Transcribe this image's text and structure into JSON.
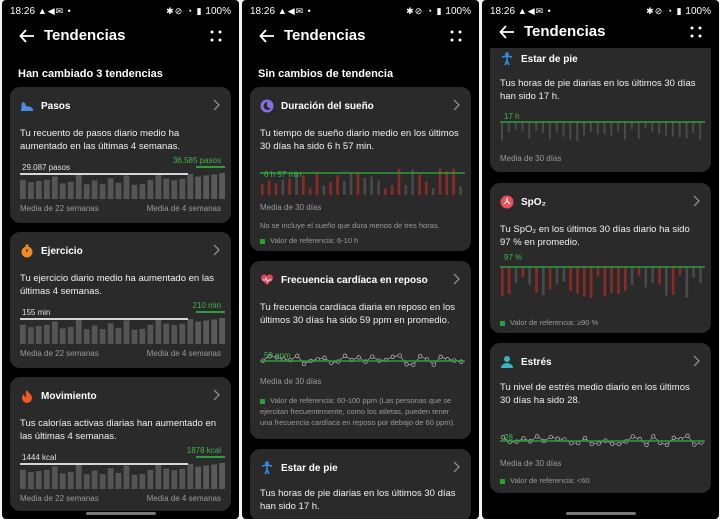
{
  "statusbar": {
    "time": "18:26",
    "left_icons": "▲◀✉ •",
    "right_icons": "✱⊘ ◔ ▮",
    "battery": "100%"
  },
  "appbar": {
    "title": "Tendencias"
  },
  "colors": {
    "card": "#2a2a2a",
    "accent_green": "#2e9d3e",
    "bar_grey": "#5a5a5a",
    "bar_red": "#8b2b25",
    "line_light": "#d6d6d6"
  },
  "screen1": {
    "section": "Han cambiado 3 tendencias",
    "pasos": {
      "title": "Pasos",
      "desc": "Tu recuento de pasos diario medio ha aumentado en las últimas 4 semanas.",
      "left_value": "29.087 pasos",
      "right_value": "36.585 pasos",
      "left_caption": "Media de 22 semanas",
      "right_caption": "Media de 4 semanas"
    },
    "ejercicio": {
      "title": "Ejercicio",
      "desc": "Tu ejercicio diario medio ha aumentado en las últimas 4 semanas.",
      "left_value": "155 min",
      "right_value": "210 min",
      "left_caption": "Media de 22 semanas",
      "right_caption": "Media de 4 semanas"
    },
    "movimiento": {
      "title": "Movimiento",
      "desc": "Tus calorías activas diarias han aumentado en las últimas 4 semanas.",
      "left_value": "1444 kcal",
      "right_value": "1878 kcal",
      "left_caption": "Media de 22 semanas",
      "right_caption": "Media de 4 semanas"
    }
  },
  "screen2": {
    "section": "Sin cambios de tendencia",
    "sueno": {
      "title": "Duración del sueño",
      "desc": "Tu tiempo de sueño diario medio en los últimos 30 días ha sido 6 h 57 min.",
      "line_label": "6 h 57 min",
      "caption": "Media de 30 días",
      "note": "No se incluye el sueño que dura menos de tres horas.",
      "ref": "Valor de referencia: 6-10 h"
    },
    "frecuencia": {
      "title": "Frecuencia cardíaca en reposo",
      "desc": "Tu frecuencia cardíaca diaria en reposo en los últimos 30 días ha sido 59 ppm en promedio.",
      "line_label": "59 ppm",
      "caption": "Media de 30 días",
      "ref": "Valor de referencia: 60-100 ppm (Las personas que se ejercitan frecuentemente, como los atletas, pueden tener una frecuencia cardíaca en reposo por debajo de 60 ppm)."
    },
    "pie": {
      "title": "Estar de pie",
      "desc": "Tus horas de pie diarias en los últimos 30 días han sido 17 h."
    }
  },
  "screen3": {
    "pie": {
      "title": "Estar de pie",
      "desc": "Tus horas de pie diarias en los últimos 30 días han sido 17 h.",
      "line_label": "17 h",
      "caption": "Media de 30 días"
    },
    "spo2": {
      "title": "SpO₂",
      "desc": "Tu SpO₂ en los últimos 30 días diario ha sido 97 % en promedio.",
      "line_label": "97 %",
      "ref": "Valor de referencia: ≥90 %"
    },
    "estres": {
      "title": "Estrés",
      "desc": "Tu nivel de estrés medio diario en los últimos 30 días ha sido 28.",
      "line_label": "28",
      "caption": "Media de 30 días",
      "ref": "Valor de referencia: <60"
    }
  }
}
